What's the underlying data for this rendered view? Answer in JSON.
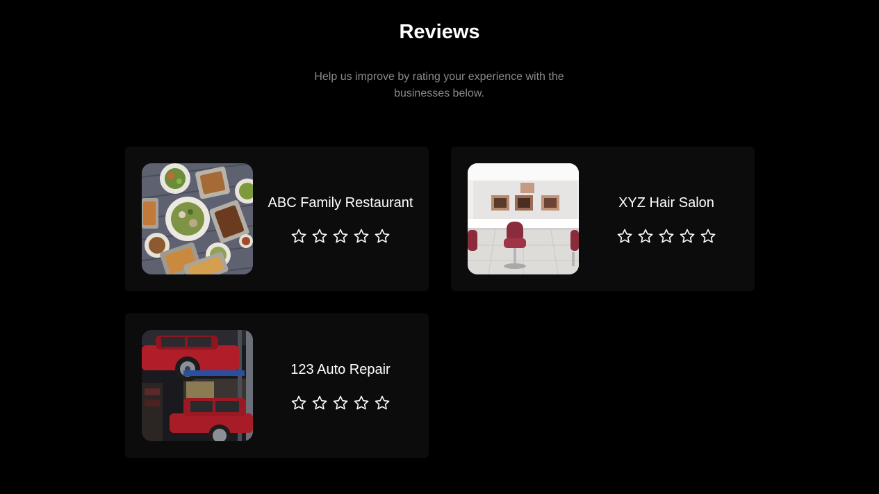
{
  "header": {
    "title": "Reviews",
    "subtitle": "Help us improve by rating your experience with the businesses below."
  },
  "businesses": [
    {
      "name": "ABC Family Restaurant",
      "image_icon": "restaurant-food-photo",
      "rating": 0,
      "max_rating": 5
    },
    {
      "name": "XYZ Hair Salon",
      "image_icon": "hair-salon-photo",
      "rating": 0,
      "max_rating": 5
    },
    {
      "name": "123 Auto Repair",
      "image_icon": "auto-repair-photo",
      "rating": 0,
      "max_rating": 5
    }
  ],
  "colors": {
    "background": "#000000",
    "card": "#0c0c0c",
    "text": "#ffffff",
    "muted": "#8a8a8a"
  }
}
